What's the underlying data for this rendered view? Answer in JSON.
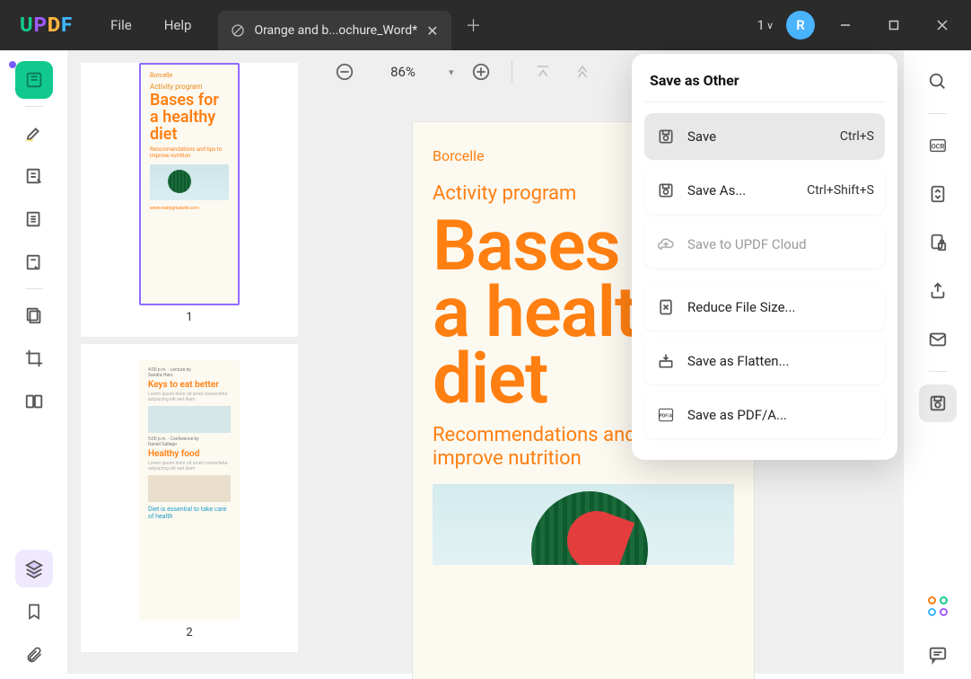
{
  "titlebar": {
    "menu": [
      "File",
      "Help"
    ],
    "tab_label": "Orange and b...ochure_Word*",
    "count": "1",
    "avatar_letter": "R"
  },
  "toolbar": {
    "zoom": "86%"
  },
  "thumbnails": {
    "page1_num": "1",
    "page2_num": "2"
  },
  "document": {
    "brand": "Borcelle",
    "program": "Activity program",
    "headline": "Bases for a healthy diet",
    "recommend": "Recommendations and tips to improve nutrition",
    "url": "www.reallygreatsite.com",
    "p2_time1": "4:00 p.m. - Lecture by",
    "p2_author1": "Sandra Haro",
    "p2_h1": "Keys to eat better",
    "p2_time2": "5:00 p.m. - Conference by",
    "p2_author2": "Daniel Gallego",
    "p2_h2": "Healthy food",
    "p2_foot": "Diet is essential to take care of health"
  },
  "panel": {
    "title": "Save as Other",
    "items": {
      "save": {
        "label": "Save",
        "shortcut": "Ctrl+S"
      },
      "save_as": {
        "label": "Save As...",
        "shortcut": "Ctrl+Shift+S"
      },
      "cloud": {
        "label": "Save to UPDF Cloud"
      },
      "reduce": {
        "label": "Reduce File Size..."
      },
      "flatten": {
        "label": "Save as Flatten..."
      },
      "pdfa": {
        "label": "Save as PDF/A..."
      }
    }
  }
}
